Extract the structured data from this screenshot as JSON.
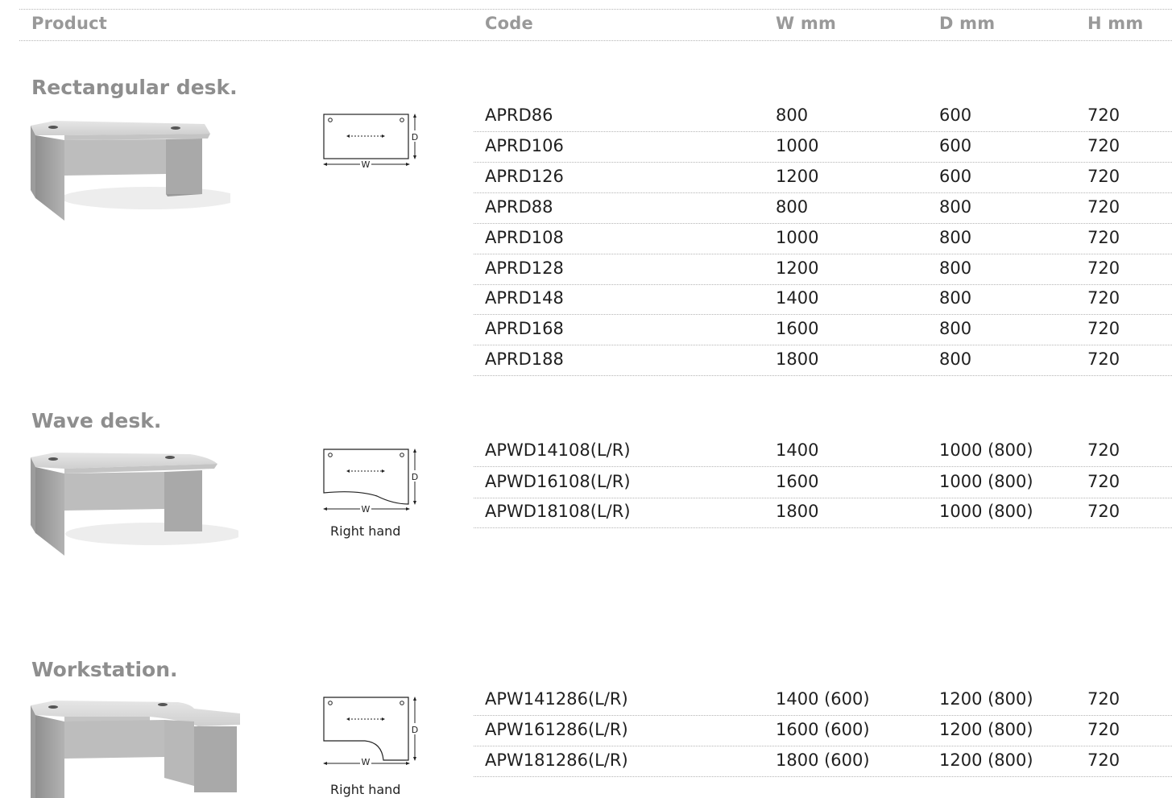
{
  "header": {
    "product": "Product",
    "code": "Code",
    "w": "W mm",
    "d": "D mm",
    "h": "H mm"
  },
  "sections": [
    {
      "title": "Rectangular desk.",
      "photo_icon": "desk-photo",
      "diagram_icon": "rectangular-desk-diagram",
      "diagram_labels": {
        "w": "W",
        "d": "D"
      },
      "rows": [
        {
          "code": "APRD86",
          "w": "800",
          "d": "600",
          "h": "720"
        },
        {
          "code": "APRD106",
          "w": "1000",
          "d": "600",
          "h": "720"
        },
        {
          "code": "APRD126",
          "w": "1200",
          "d": "600",
          "h": "720"
        },
        {
          "code": "APRD88",
          "w": "800",
          "d": "800",
          "h": "720"
        },
        {
          "code": "APRD108",
          "w": "1000",
          "d": "800",
          "h": "720"
        },
        {
          "code": "APRD128",
          "w": "1200",
          "d": "800",
          "h": "720"
        },
        {
          "code": "APRD148",
          "w": "1400",
          "d": "800",
          "h": "720"
        },
        {
          "code": "APRD168",
          "w": "1600",
          "d": "800",
          "h": "720"
        },
        {
          "code": "APRD188",
          "w": "1800",
          "d": "800",
          "h": "720"
        }
      ]
    },
    {
      "title": "Wave desk.",
      "photo_icon": "wave-desk-photo",
      "diagram_icon": "wave-desk-diagram",
      "diagram_labels": {
        "w": "W",
        "d": "D"
      },
      "caption": "Right hand",
      "rows": [
        {
          "code": "APWD14108(L/R)",
          "w": "1400",
          "d": "1000 (800)",
          "h": "720"
        },
        {
          "code": "APWD16108(L/R)",
          "w": "1600",
          "d": "1000 (800)",
          "h": "720"
        },
        {
          "code": "APWD18108(L/R)",
          "w": "1800",
          "d": "1000 (800)",
          "h": "720"
        }
      ]
    },
    {
      "title": "Workstation.",
      "photo_icon": "workstation-photo",
      "diagram_icon": "workstation-diagram",
      "diagram_labels": {
        "w": "W",
        "d": "D"
      },
      "caption": "Right hand",
      "rows": [
        {
          "code": "APW141286(L/R)",
          "w": "1400 (600)",
          "d": "1200 (800)",
          "h": "720"
        },
        {
          "code": "APW161286(L/R)",
          "w": "1600 (600)",
          "d": "1200 (800)",
          "h": "720"
        },
        {
          "code": "APW181286(L/R)",
          "w": "1800 (600)",
          "d": "1200 (800)",
          "h": "720"
        }
      ]
    }
  ]
}
